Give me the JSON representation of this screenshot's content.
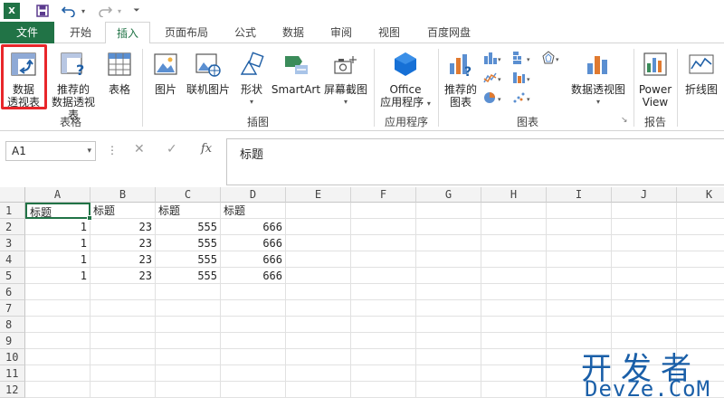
{
  "qat": {
    "app_icon": "excel-icon",
    "save_icon": "save-icon",
    "undo_icon": "undo-icon",
    "redo_icon": "redo-icon",
    "customize_icon": "customize-qat-icon"
  },
  "tabs": [
    {
      "label": "文件"
    },
    {
      "label": "开始"
    },
    {
      "label": "插入"
    },
    {
      "label": "页面布局"
    },
    {
      "label": "公式"
    },
    {
      "label": "数据"
    },
    {
      "label": "审阅"
    },
    {
      "label": "视图"
    },
    {
      "label": "百度网盘"
    }
  ],
  "ribbon": {
    "pivot_table": {
      "line1": "数据",
      "line2": "透视表"
    },
    "recommended_pivot": {
      "line1": "推荐的",
      "line2": "数据透视表"
    },
    "table": {
      "label": "表格"
    },
    "group_tables": "表格",
    "picture": {
      "label": "图片"
    },
    "online_picture": {
      "label": "联机图片"
    },
    "shapes": {
      "label": "形状"
    },
    "smartart": {
      "label": "SmartArt"
    },
    "screenshot": {
      "label": "屏幕截图"
    },
    "group_illustrations": "插图",
    "office_apps": {
      "line1": "Office",
      "line2": "应用程序"
    },
    "group_apps": "应用程序",
    "recommended_charts": {
      "line1": "推荐的",
      "line2": "图表"
    },
    "pivot_chart": {
      "label": "数据透视图"
    },
    "group_charts": "图表",
    "power_view": {
      "line1": "Power",
      "line2": "View"
    },
    "group_reports": "报告",
    "sparkline_line": {
      "label": "折线图"
    }
  },
  "formula_bar": {
    "name_box": "A1",
    "dots": "⋮",
    "cancel": "✕",
    "enter": "✓",
    "fx": "fx",
    "content": "标题"
  },
  "grid": {
    "columns": [
      "A",
      "B",
      "C",
      "D",
      "E",
      "F",
      "G",
      "H",
      "I",
      "J",
      "K"
    ],
    "rows": [
      "1",
      "2",
      "3",
      "4",
      "5",
      "6",
      "7",
      "8",
      "9",
      "10",
      "11",
      "12"
    ],
    "cells": [
      [
        "标题",
        "标题",
        "标题",
        "标题"
      ],
      [
        "1",
        "23",
        "555",
        "666"
      ],
      [
        "1",
        "23",
        "555",
        "666"
      ],
      [
        "1",
        "23",
        "555",
        "666"
      ],
      [
        "1",
        "23",
        "555",
        "666"
      ]
    ],
    "selected_cell": "A1"
  },
  "watermark": {
    "line1": "开发者",
    "line2": "DevZe.CoM"
  },
  "colors": {
    "excel_green": "#217346",
    "highlight_red": "#e8262a",
    "watermark_blue": "#1a5fa8"
  }
}
